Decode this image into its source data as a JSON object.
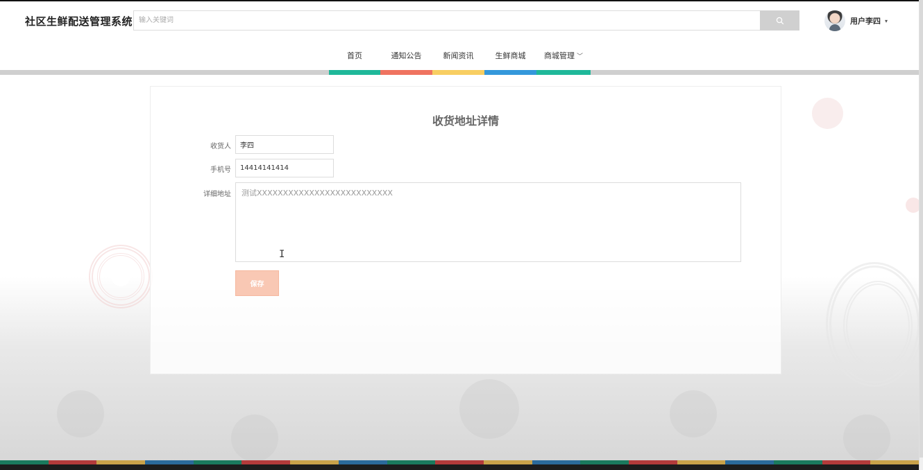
{
  "app": {
    "title": "社区生鲜配送管理系统"
  },
  "search": {
    "placeholder": "输入关键词",
    "button_icon": "search-icon"
  },
  "user": {
    "name": "用户李四",
    "caret": "▾"
  },
  "nav": {
    "items": [
      {
        "label": "首页",
        "color": "#1fb89a"
      },
      {
        "label": "通知公告",
        "color": "#ef7360"
      },
      {
        "label": "新闻资讯",
        "color": "#f8ce62"
      },
      {
        "label": "生鲜商城",
        "color": "#3498db"
      },
      {
        "label": "商城管理",
        "color": "#1fb89a",
        "has_dropdown": true
      }
    ],
    "dropdown_caret": "﹀"
  },
  "form": {
    "title": "收货地址详情",
    "consignee_label": "收货人",
    "consignee_value": "李四",
    "phone_label": "手机号",
    "phone_value": "14414141414",
    "address_label": "详细地址",
    "address_value": "测试XXXXXXXXXXXXXXXXXXXXXXXXXX",
    "save_label": "保存"
  },
  "colors": {
    "accent_green": "#1fb89a",
    "accent_red": "#ef7360",
    "accent_yellow": "#f8ce62",
    "accent_blue": "#3498db",
    "save_button": "#f9c8b4"
  },
  "bottom_strip_colors": [
    "#1a7a5e",
    "#b33b3b",
    "#c9a24a",
    "#2b6a9b",
    "#1a7a5e",
    "#b33b3b",
    "#c9a24a",
    "#2b6a9b",
    "#1a7a5e",
    "#b33b3b",
    "#c9a24a",
    "#2b6a9b",
    "#1a7a5e",
    "#b33b3b",
    "#c9a24a",
    "#2b6a9b",
    "#1a7a5e",
    "#b33b3b",
    "#c9a24a"
  ]
}
